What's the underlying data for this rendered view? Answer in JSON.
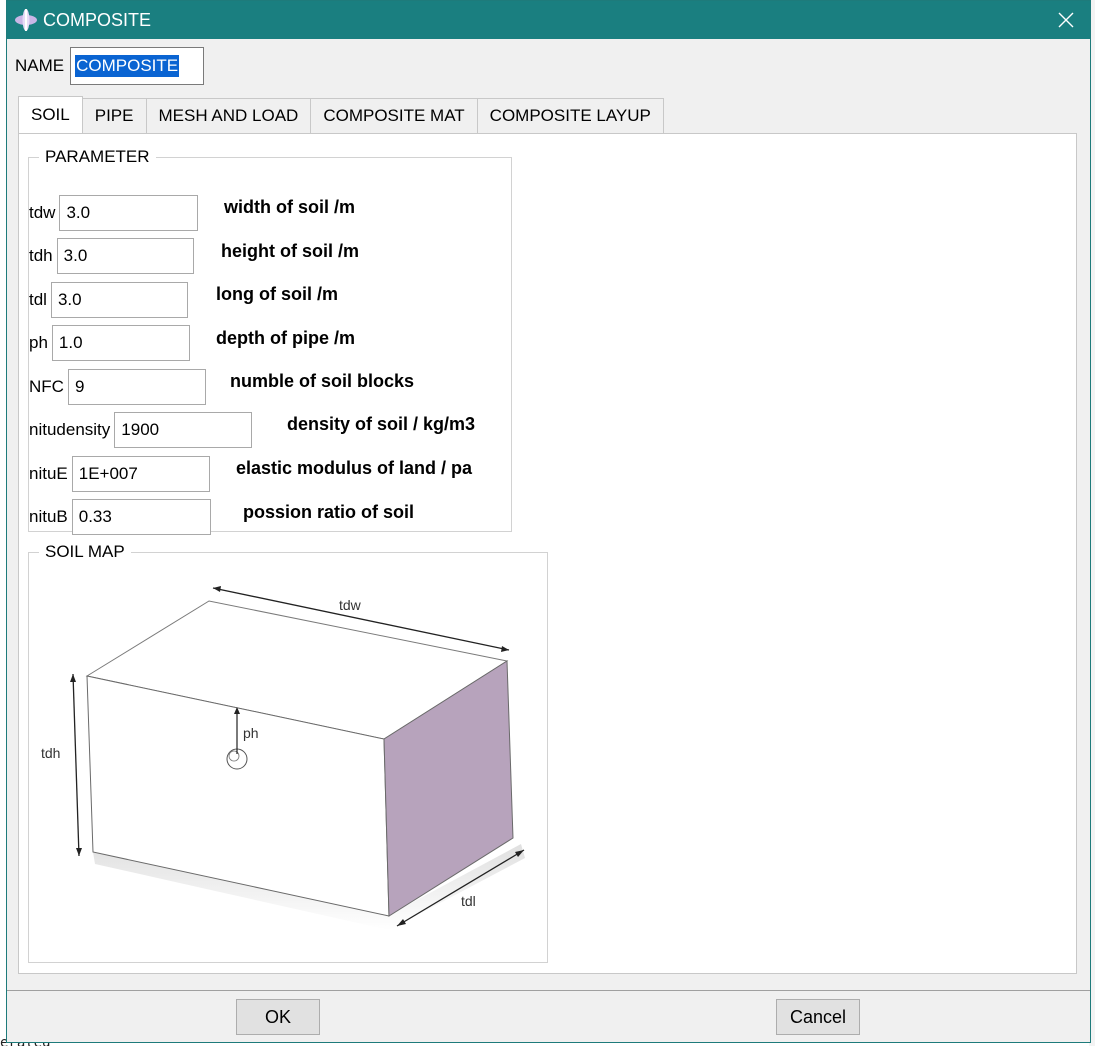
{
  "window": {
    "title": "COMPOSITE",
    "colors": {
      "titlebar": "#1a7f80",
      "selection": "#0a64d2",
      "face": "#b7a3bc"
    }
  },
  "name_field": {
    "label": "NAME",
    "value": "COMPOSITE"
  },
  "tabs": [
    {
      "label": "SOIL",
      "active": true
    },
    {
      "label": "PIPE",
      "active": false
    },
    {
      "label": "MESH AND LOAD",
      "active": false
    },
    {
      "label": "COMPOSITE MAT",
      "active": false
    },
    {
      "label": "COMPOSITE LAYUP",
      "active": false
    }
  ],
  "parameter_group": {
    "title": "PARAMETER",
    "rows": [
      {
        "label": "tdw",
        "value": "3.0",
        "description": "width of soil /m"
      },
      {
        "label": "tdh",
        "value": "3.0",
        "description": "height of soil /m"
      },
      {
        "label": "tdl",
        "value": "3.0",
        "description": "long of soil /m"
      },
      {
        "label": "ph",
        "value": "1.0",
        "description": "depth of pipe /m"
      },
      {
        "label": "NFC",
        "value": "9",
        "description": "numble of soil blocks"
      },
      {
        "label": "nitudensity",
        "value": "1900",
        "description": "density of soil / kg/m3"
      },
      {
        "label": "nituE",
        "value": "1E+007",
        "description": "elastic modulus of land / pa"
      },
      {
        "label": "nituB",
        "value": "0.33",
        "description": "possion ratio of soil"
      }
    ]
  },
  "soil_map_group": {
    "title": "SOIL MAP",
    "labels": {
      "width": "tdw",
      "height": "tdh",
      "depth": "ph",
      "length": "tdl"
    }
  },
  "buttons": {
    "ok": "OK",
    "cancel": "Cancel"
  },
  "background": {
    "bottom_text": "erated"
  }
}
